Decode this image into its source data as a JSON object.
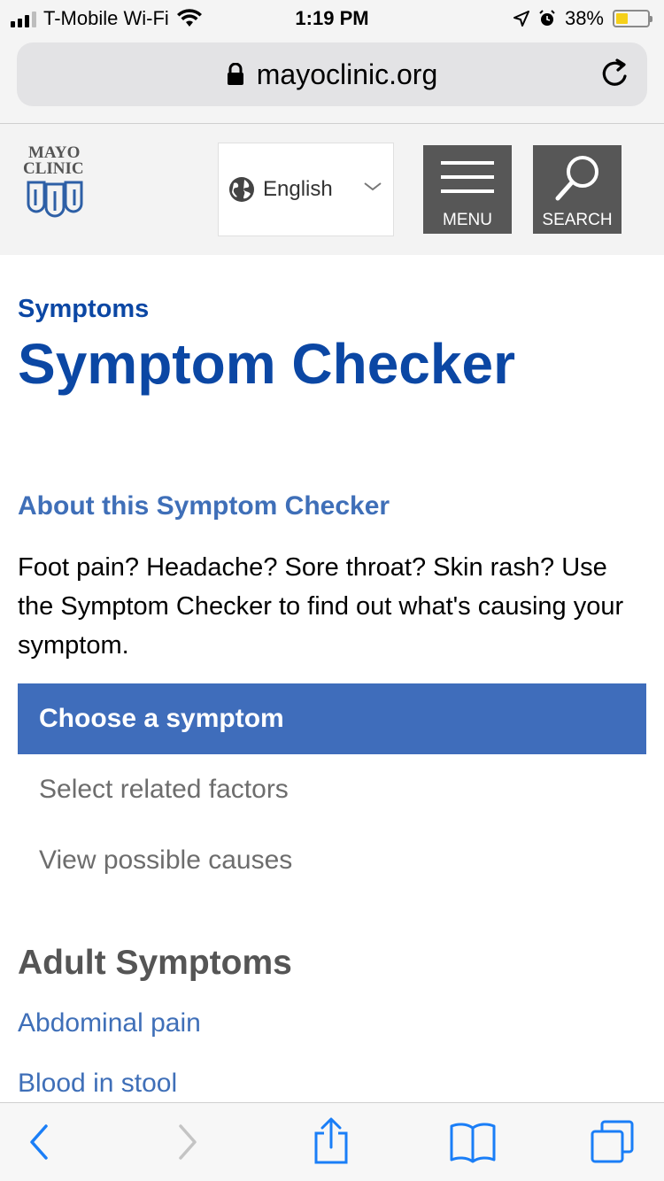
{
  "status_bar": {
    "carrier": "T-Mobile Wi-Fi",
    "time": "1:19 PM",
    "battery": "38%",
    "battery_level": 0.38,
    "icons": [
      "signal-icon",
      "wifi-icon",
      "location-arrow-icon",
      "alarm-icon",
      "battery-icon"
    ]
  },
  "browser": {
    "url": "mayoclinic.org",
    "icons": [
      "lock-icon",
      "reload-icon"
    ]
  },
  "site_header": {
    "logo_line1": "MAYO",
    "logo_line2": "CLINIC",
    "language": "English",
    "menu_label": "MENU",
    "search_label": "SEARCH"
  },
  "page": {
    "breadcrumb": "Symptoms",
    "title": "Symptom Checker",
    "about_link": "About this Symptom Checker",
    "intro": "Foot pain? Headache? Sore throat? Skin rash? Use the Symptom Checker to find out what's causing your symptom.",
    "steps": [
      {
        "label": "Choose a symptom",
        "active": true
      },
      {
        "label": "Select related factors",
        "active": false
      },
      {
        "label": "View possible causes",
        "active": false
      }
    ],
    "adult_heading": "Adult Symptoms",
    "symptoms": [
      "Abdominal pain",
      "Blood in stool"
    ]
  },
  "toolbar": {
    "icons": [
      "back-icon",
      "forward-icon",
      "share-icon",
      "bookmarks-icon",
      "tabs-icon"
    ]
  },
  "colors": {
    "brand_blue": "#0b47a4",
    "link_blue": "#3f6fb8",
    "active_step": "#3f6dbb",
    "header_button": "#575757",
    "battery_fill": "#f5d01a",
    "ios_blue": "#1a7ef7"
  }
}
